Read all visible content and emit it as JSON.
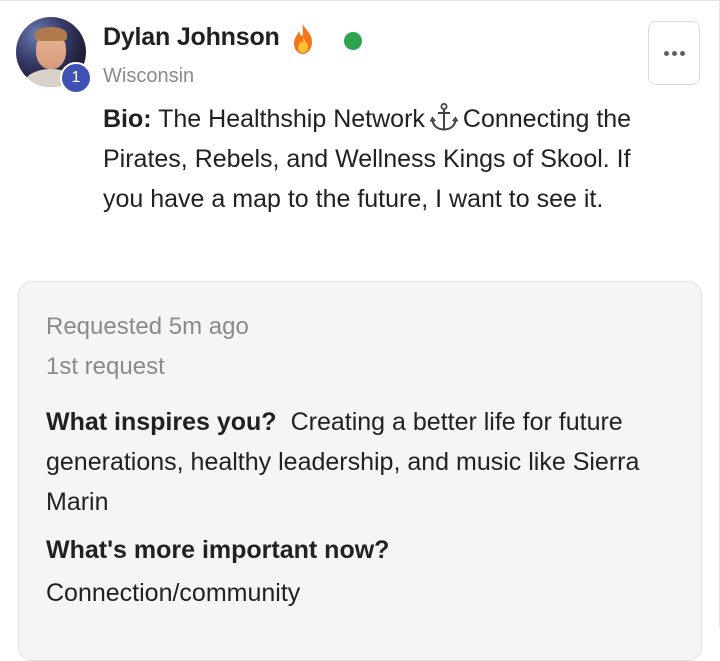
{
  "profile": {
    "name": "Dylan Johnson",
    "level": "1",
    "location": "Wisconsin",
    "bio_label": "Bio:",
    "bio_part1": "The Healthship Network",
    "bio_part2": "Connecting the Pirates, Rebels, and Wellness Kings of Skool. If you have a map to the future, I want to see it.",
    "status": "online",
    "status_color": "#2ea44f"
  },
  "icons": {
    "status_emoji": "fire-icon",
    "bio_emoji": "anchor-icon",
    "menu": "more-horizontal-icon"
  },
  "request": {
    "time": "Requested 5m ago",
    "count": "1st request",
    "questions": [
      {
        "question": "What inspires you?",
        "answer": "Creating a better life for future generations, healthy leadership, and music like Sierra Marin"
      },
      {
        "question": "What's more important now?",
        "answer": "Connection/community"
      }
    ]
  },
  "colors": {
    "level_badge": "#3f51b5",
    "muted_text": "#8a8a8a",
    "panel_bg": "#f5f5f5"
  }
}
